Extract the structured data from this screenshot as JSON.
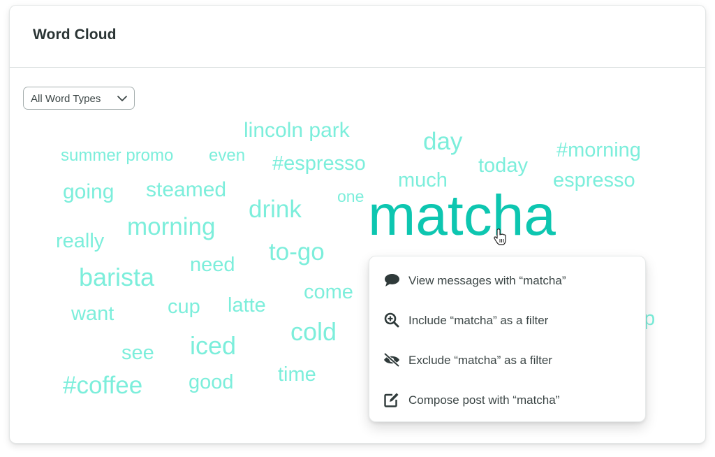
{
  "card": {
    "title": "Word Cloud"
  },
  "filter": {
    "selected": "All Word Types",
    "icon": "chevron-down-icon"
  },
  "colors": {
    "word": "#7ceedb",
    "top_word": "#0dc6b0",
    "title_text": "#2a3434",
    "menu_text": "#3b4545",
    "menu_icon": "#2f3a3a"
  },
  "words": [
    {
      "text": "matcha",
      "rank": "top"
    },
    {
      "text": "lincoln park"
    },
    {
      "text": "summer promo"
    },
    {
      "text": "even"
    },
    {
      "text": "#espresso"
    },
    {
      "text": "day"
    },
    {
      "text": "#morning"
    },
    {
      "text": "today"
    },
    {
      "text": "much"
    },
    {
      "text": "espresso"
    },
    {
      "text": "going"
    },
    {
      "text": "steamed"
    },
    {
      "text": "one"
    },
    {
      "text": "drink"
    },
    {
      "text": "morning"
    },
    {
      "text": "really"
    },
    {
      "text": "to-go"
    },
    {
      "text": "need"
    },
    {
      "text": "barista"
    },
    {
      "text": "come"
    },
    {
      "text": "want"
    },
    {
      "text": "cup"
    },
    {
      "text": "latte"
    },
    {
      "text": "cold"
    },
    {
      "text": "see"
    },
    {
      "text": "iced"
    },
    {
      "text": "time"
    },
    {
      "text": "#coffee"
    },
    {
      "text": "good"
    },
    {
      "text": "op"
    }
  ],
  "context_menu": {
    "target_word": "matcha",
    "items": [
      {
        "label": "View messages with “matcha”",
        "icon": "speech-bubble-icon"
      },
      {
        "label": "Include “matcha” as a filter",
        "icon": "zoom-in-icon"
      },
      {
        "label": "Exclude “matcha” as a filter",
        "icon": "eye-slash-icon"
      },
      {
        "label": "Compose post with “matcha”",
        "icon": "edit-icon"
      }
    ]
  },
  "cursor": {
    "icon": "hand-pointer-icon"
  }
}
